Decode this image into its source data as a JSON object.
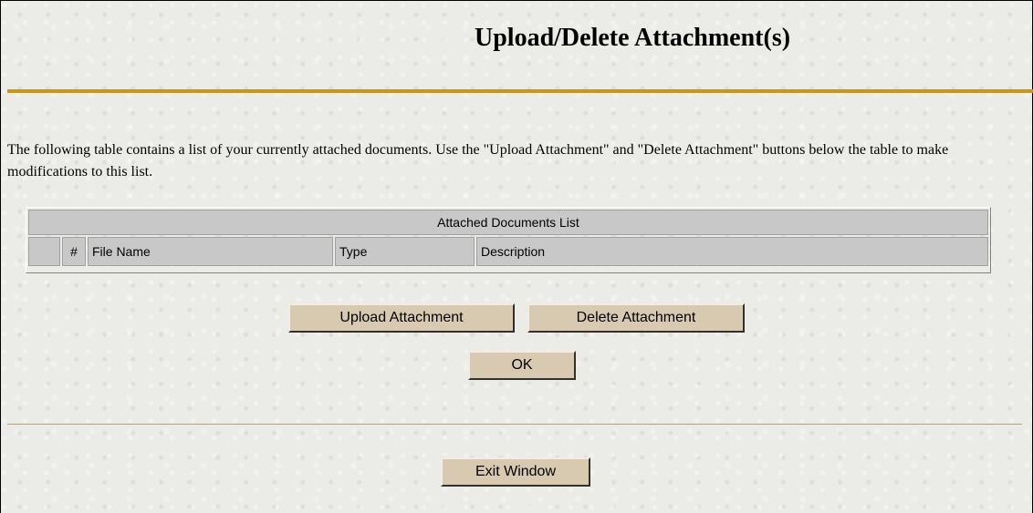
{
  "page": {
    "title": "Upload/Delete Attachment(s)",
    "intro": "The following table contains a list of your currently attached documents. Use the \"Upload Attachment\" and \"Delete Attachment\" buttons below the table to make modifications to this list."
  },
  "table": {
    "caption": "Attached Documents List",
    "columns": [
      "",
      "#",
      "File Name",
      "Type",
      "Description"
    ],
    "rows": []
  },
  "actions": {
    "upload_label": "Upload Attachment",
    "delete_label": "Delete Attachment",
    "ok_label": "OK",
    "exit_label": "Exit Window"
  },
  "colors": {
    "background": "#ebebe7",
    "title_rule": "#c8961a",
    "button_face": "#d8cab0",
    "table_header": "#c8c8c8"
  }
}
